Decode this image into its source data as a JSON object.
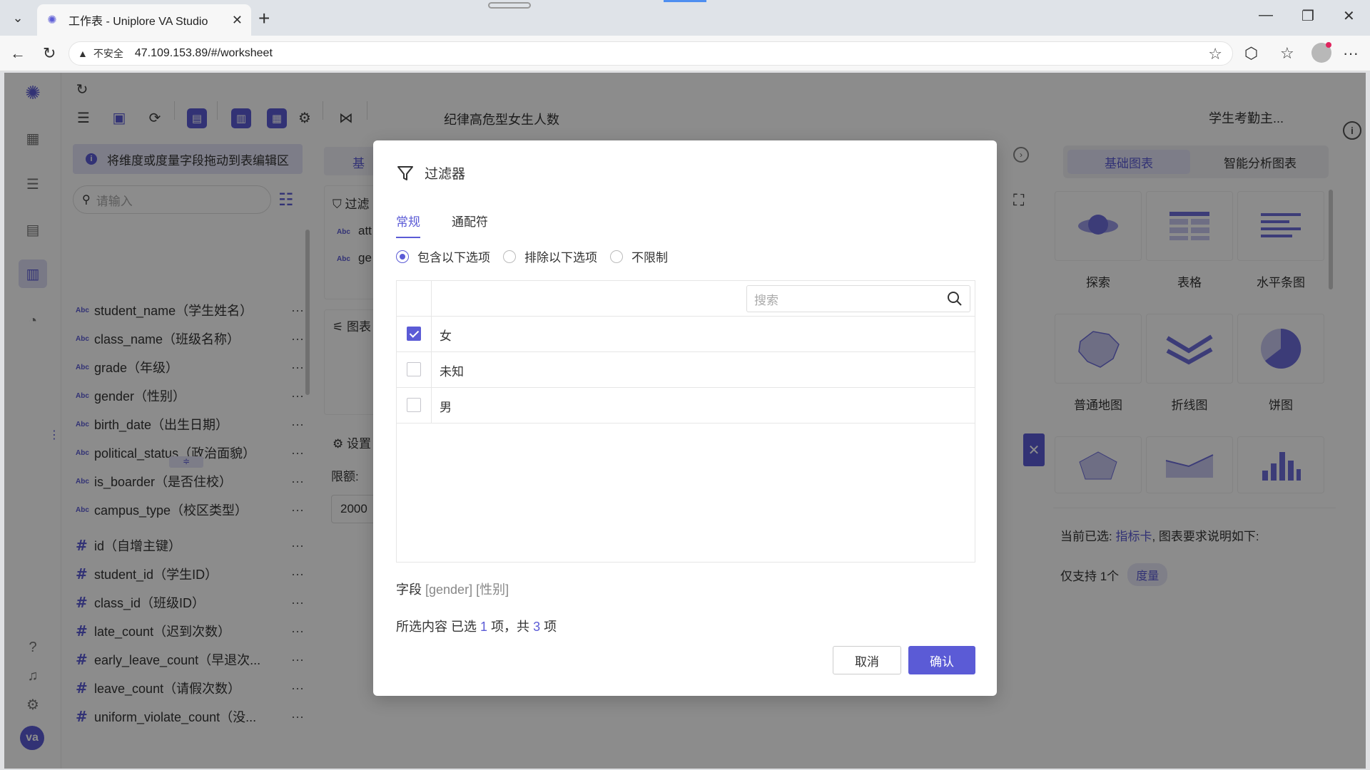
{
  "browser": {
    "tab_title": "工作表 - Uniplore VA Studio",
    "insecure_label": "不安全",
    "url": "47.109.153.89/#/worksheet"
  },
  "toolbar": {
    "worksheet_title": "纪律高危型女生人数",
    "datasource_name": "学生考勤主..."
  },
  "fields_panel": {
    "hint": "将维度或度量字段拖动到表编辑区",
    "search_placeholder": "请输入",
    "dimensions": [
      {
        "type": "Abc",
        "name": "student_name（学生姓名）"
      },
      {
        "type": "Abc",
        "name": "class_name（班级名称）"
      },
      {
        "type": "Abc",
        "name": "grade（年级）"
      },
      {
        "type": "Abc",
        "name": "gender（性别）"
      },
      {
        "type": "Abc",
        "name": "birth_date（出生日期）"
      },
      {
        "type": "Abc",
        "name": "political_status（政治面貌）"
      },
      {
        "type": "Abc",
        "name": "is_boarder（是否住校）"
      },
      {
        "type": "Abc",
        "name": "campus_type（校区类型）"
      }
    ],
    "measures": [
      {
        "type": "#",
        "name": "id（自增主键）"
      },
      {
        "type": "#",
        "name": "student_id（学生ID）"
      },
      {
        "type": "#",
        "name": "class_id（班级ID）"
      },
      {
        "type": "#",
        "name": "late_count（迟到次数）"
      },
      {
        "type": "#",
        "name": "early_leave_count（早退次..."
      },
      {
        "type": "#",
        "name": "leave_count（请假次数）"
      },
      {
        "type": "#",
        "name": "uniform_violate_count（没..."
      }
    ],
    "more_label": "···"
  },
  "middle_panel": {
    "tab_label": "基",
    "filter_label": "过滤",
    "filter_items": [
      "att",
      "ge"
    ],
    "abc": "Abc",
    "chart_label": "图表",
    "settings_label": "设置",
    "limit_label": "限额:",
    "limit_value": "2000"
  },
  "right_panel": {
    "tabs": [
      "基础图表",
      "智能分析图表"
    ],
    "charts": [
      "探索",
      "表格",
      "水平条图",
      "普通地图",
      "折线图",
      "饼图"
    ],
    "note_prefix": "当前已选:",
    "note_link": "指标卡",
    "note_suffix": ", 图表要求说明如下:",
    "support_text": "仅支持 1个",
    "support_tag": "度量"
  },
  "modal": {
    "title": "过滤器",
    "tabs": [
      "常规",
      "通配符"
    ],
    "radio_options": [
      "包含以下选项",
      "排除以下选项",
      "不限制"
    ],
    "search_placeholder": "搜索",
    "options": [
      {
        "label": "女",
        "checked": true
      },
      {
        "label": "未知",
        "checked": false
      },
      {
        "label": "男",
        "checked": false
      }
    ],
    "field_label": "字段",
    "field_value": "[gender] [性别]",
    "selection_label": "所选内容",
    "selected_prefix": "已选",
    "selected_count": "1",
    "selected_mid": "项，共",
    "total_count": "3",
    "selected_suffix": "项",
    "cancel_label": "取消",
    "confirm_label": "确认"
  },
  "user": {
    "avatar_text": "va"
  },
  "colors": {
    "accent": "#5b5bd6",
    "accent_light": "#e4e4f7"
  }
}
